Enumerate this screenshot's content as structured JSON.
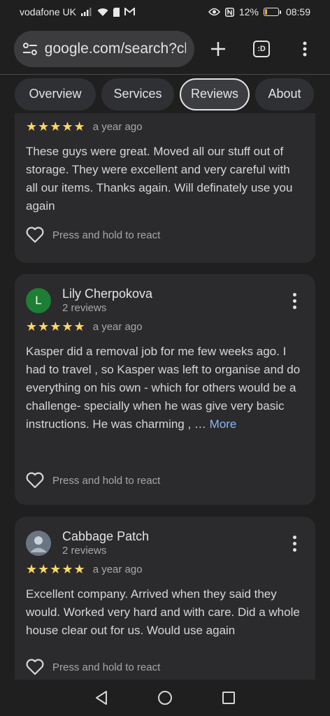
{
  "status": {
    "carrier": "vodafone UK",
    "battery": "12%",
    "time": "08:59"
  },
  "browser": {
    "url": "google.com/search?cl",
    "tab_count": ":D"
  },
  "tabs": [
    {
      "label": "Overview"
    },
    {
      "label": "Services"
    },
    {
      "label": "Reviews"
    },
    {
      "label": "About"
    }
  ],
  "reviews": [
    {
      "stars": "★★★★★",
      "time": "a year ago",
      "text": "These guys were great. Moved all our stuff out of storage. They were excellent and very careful with all our items. Thanks again. Will definately use you again",
      "react": "Press and hold to react"
    },
    {
      "initial": "L",
      "avatar_color": "#1e7e34",
      "name": "Lily Cherpokova",
      "count": "2 reviews",
      "stars": "★★★★★",
      "time": "a year ago",
      "text": "Kasper did a removal job for me few weeks ago. I had to travel , so Kasper was left to organise and do everything on his own - which for others would be a challenge- specially when he was give very basic instructions. He was charming , …",
      "more": "More",
      "react": "Press and hold to react"
    },
    {
      "name": "Cabbage Patch",
      "count": "2 reviews",
      "stars": "★★★★★",
      "time": "a year ago",
      "text": "Excellent company. Arrived when they said they would. Worked very hard and with care. Did a whole house clear out for us. Would use again",
      "react": "Press and hold to react"
    }
  ]
}
